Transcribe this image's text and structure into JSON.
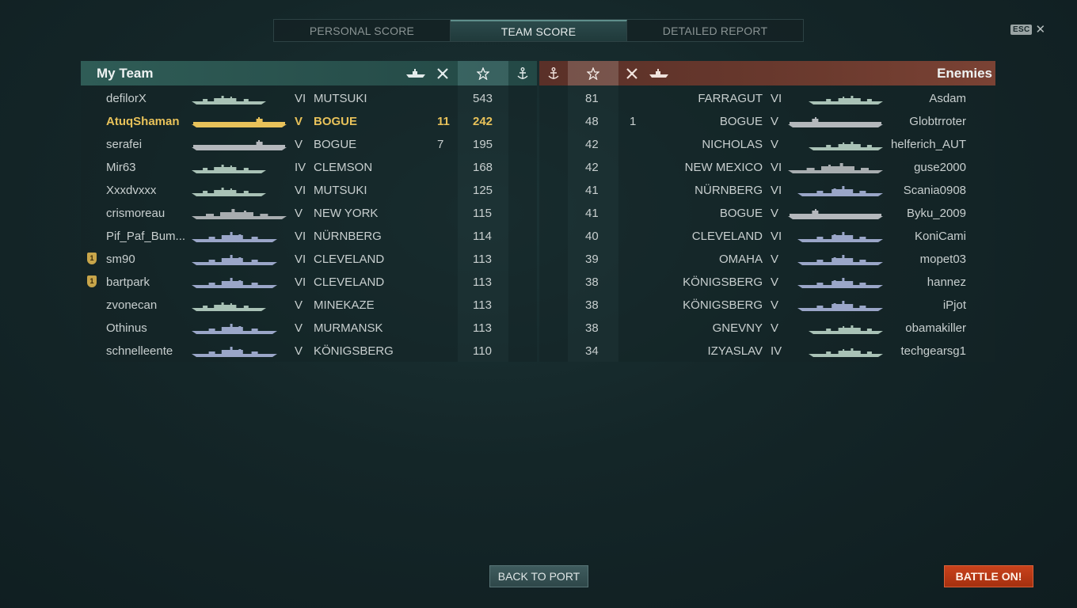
{
  "tabs": [
    {
      "label": "PERSONAL SCORE",
      "active": false
    },
    {
      "label": "TEAM SCORE",
      "active": true
    },
    {
      "label": "DETAILED REPORT",
      "active": false
    }
  ],
  "esc": {
    "key": "ESC",
    "close": "✕"
  },
  "my_team": {
    "title": "My Team",
    "header_icons": [
      "ship-icon",
      "planes-icon",
      "star-icon",
      "anchor-icon"
    ],
    "rows": [
      {
        "player": "defilorX",
        "tier": "VI",
        "ship": "MUTSUKI",
        "planes": "",
        "score": "543",
        "ship_class": "destroyer",
        "highlight": false,
        "medal": false
      },
      {
        "player": "AtuqShaman",
        "tier": "V",
        "ship": "BOGUE",
        "planes": "11",
        "score": "242",
        "ship_class": "carrier",
        "highlight": true,
        "medal": false
      },
      {
        "player": "serafei",
        "tier": "V",
        "ship": "BOGUE",
        "planes": "7",
        "score": "195",
        "ship_class": "carrier",
        "highlight": false,
        "medal": false
      },
      {
        "player": "Mir63",
        "tier": "IV",
        "ship": "CLEMSON",
        "planes": "",
        "score": "168",
        "ship_class": "destroyer",
        "highlight": false,
        "medal": false
      },
      {
        "player": "Xxxdvxxx",
        "tier": "VI",
        "ship": "MUTSUKI",
        "planes": "",
        "score": "125",
        "ship_class": "destroyer",
        "highlight": false,
        "medal": false
      },
      {
        "player": "crismoreau",
        "tier": "V",
        "ship": "NEW YORK",
        "planes": "",
        "score": "115",
        "ship_class": "battleship",
        "highlight": false,
        "medal": false
      },
      {
        "player": "Pif_Paf_Bum...",
        "tier": "VI",
        "ship": "NÜRNBERG",
        "planes": "",
        "score": "114",
        "ship_class": "cruiser",
        "highlight": false,
        "medal": false
      },
      {
        "player": "sm90",
        "tier": "VI",
        "ship": "CLEVELAND",
        "planes": "",
        "score": "113",
        "ship_class": "cruiser",
        "highlight": false,
        "medal": true
      },
      {
        "player": "bartpark",
        "tier": "VI",
        "ship": "CLEVELAND",
        "planes": "",
        "score": "113",
        "ship_class": "cruiser",
        "highlight": false,
        "medal": true
      },
      {
        "player": "zvonecan",
        "tier": "V",
        "ship": "MINEKAZE",
        "planes": "",
        "score": "113",
        "ship_class": "destroyer",
        "highlight": false,
        "medal": false
      },
      {
        "player": "Othinus",
        "tier": "V",
        "ship": "MURMANSK",
        "planes": "",
        "score": "113",
        "ship_class": "cruiser",
        "highlight": false,
        "medal": false
      },
      {
        "player": "schnelleente",
        "tier": "V",
        "ship": "KÖNIGSBERG",
        "planes": "",
        "score": "110",
        "ship_class": "cruiser",
        "highlight": false,
        "medal": false
      }
    ]
  },
  "enemies": {
    "title": "Enemies",
    "header_icons": [
      "anchor-icon",
      "star-icon",
      "planes-icon",
      "ship-icon"
    ],
    "rows": [
      {
        "player": "Asdam",
        "tier": "VI",
        "ship": "FARRAGUT",
        "planes": "",
        "score": "81",
        "ship_class": "destroyer"
      },
      {
        "player": "Globtrroter",
        "tier": "V",
        "ship": "BOGUE",
        "planes": "1",
        "score": "48",
        "ship_class": "carrier"
      },
      {
        "player": "helferich_AUT",
        "tier": "V",
        "ship": "NICHOLAS",
        "planes": "",
        "score": "42",
        "ship_class": "destroyer"
      },
      {
        "player": "guse2000",
        "tier": "VI",
        "ship": "NEW MEXICO",
        "planes": "",
        "score": "42",
        "ship_class": "battleship"
      },
      {
        "player": "Scania0908",
        "tier": "VI",
        "ship": "NÜRNBERG",
        "planes": "",
        "score": "41",
        "ship_class": "cruiser"
      },
      {
        "player": "Byku_2009",
        "tier": "V",
        "ship": "BOGUE",
        "planes": "",
        "score": "41",
        "ship_class": "carrier"
      },
      {
        "player": "KoniCami",
        "tier": "VI",
        "ship": "CLEVELAND",
        "planes": "",
        "score": "40",
        "ship_class": "cruiser"
      },
      {
        "player": "mopet03",
        "tier": "V",
        "ship": "OMAHA",
        "planes": "",
        "score": "39",
        "ship_class": "cruiser"
      },
      {
        "player": "hannez",
        "tier": "V",
        "ship": "KÖNIGSBERG",
        "planes": "",
        "score": "38",
        "ship_class": "cruiser"
      },
      {
        "player": "iPjot",
        "tier": "V",
        "ship": "KÖNIGSBERG",
        "planes": "",
        "score": "38",
        "ship_class": "cruiser"
      },
      {
        "player": "obamakiller",
        "tier": "V",
        "ship": "GNEVNY",
        "planes": "",
        "score": "38",
        "ship_class": "destroyer"
      },
      {
        "player": "techgearsg1",
        "tier": "IV",
        "ship": "IZYASLAV",
        "planes": "",
        "score": "34",
        "ship_class": "destroyer"
      }
    ]
  },
  "buttons": {
    "back": "BACK TO PORT",
    "battle": "BATTLE ON!"
  },
  "colors": {
    "destroyer": "#a9c2b6",
    "cruiser": "#9aa6c8",
    "battleship": "#a8adb0",
    "carrier": "#b4b8bc",
    "highlight": "#e8c25a"
  }
}
